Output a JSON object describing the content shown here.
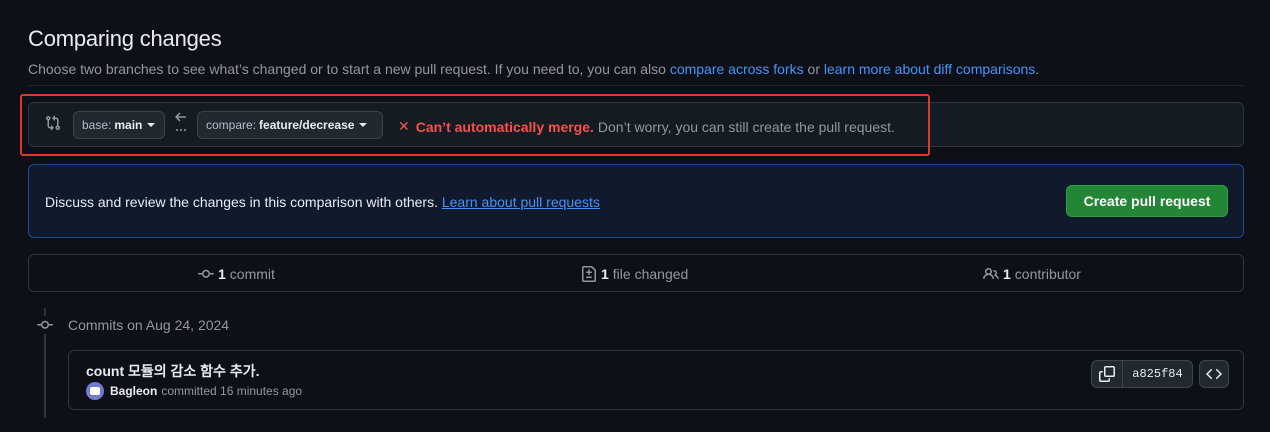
{
  "header": {
    "title": "Comparing changes",
    "subtitle_prefix": "Choose two branches to see what’s changed or to start a new pull request. If you need to, you can also ",
    "compare_forks_link": "compare across forks",
    "subtitle_or": " or ",
    "learn_more_link": "learn more about diff comparisons",
    "subtitle_suffix": "."
  },
  "range": {
    "base_prefix": "base:",
    "base_value": "main",
    "compare_prefix": "compare:",
    "compare_value": "feature/decrease",
    "merge_error": "Can’t automatically merge.",
    "merge_note": "Don’t worry, you can still create the pull request."
  },
  "discuss": {
    "text": "Discuss and review the changes in this comparison with others.",
    "link": "Learn about pull requests",
    "create_button": "Create pull request"
  },
  "stats": {
    "commits_count": "1",
    "commits_label": "commit",
    "files_count": "1",
    "files_label": "file changed",
    "contributors_count": "1",
    "contributors_label": "contributor"
  },
  "timeline": {
    "date_heading": "Commits on Aug 24, 2024"
  },
  "commit": {
    "message": "count 모듈의 감소 함수 추가.",
    "author": "Bagleon",
    "action": "committed 16 minutes ago",
    "sha": "a825f84"
  },
  "colors": {
    "background": "#0d1117",
    "accent_link": "#4493f8",
    "error": "#f85149",
    "primary_button": "#238636",
    "highlight_box": "#d83a2f"
  }
}
